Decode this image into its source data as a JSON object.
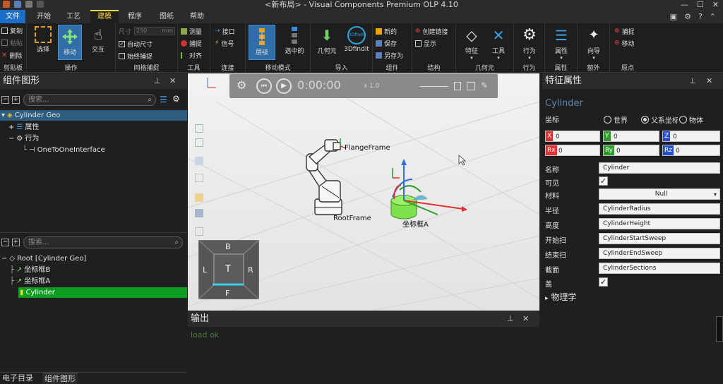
{
  "window": {
    "title": "<新布局> - Visual Components Premium OLP 4.10",
    "min_glyph": "—",
    "max_glyph": "☐",
    "close_glyph": "✕"
  },
  "menu": {
    "tabs": [
      "文件",
      "开始",
      "工艺",
      "建模",
      "程序",
      "图纸",
      "帮助"
    ],
    "active": "建模"
  },
  "ribbon": {
    "clipboard": {
      "label": "剪贴板",
      "copy": "复制",
      "paste": "粘贴",
      "delete": "删除"
    },
    "operation": {
      "label": "操作",
      "select": "选择",
      "move": "移动",
      "interact": "交互"
    },
    "grid": {
      "label": "网格捕捉",
      "size_label": "尺寸",
      "size_value": "250",
      "size_unit": "mm",
      "auto_size": "自动尺寸",
      "always_snap": "始终捕捉"
    },
    "tools": {
      "label": "工具",
      "measure": "测量",
      "snap": "捕捉",
      "align": "对齐"
    },
    "connect": {
      "label": "连接",
      "interface": "接口",
      "signal": "信号"
    },
    "move_mode": {
      "label": "移动模式",
      "hierarchy": "层级",
      "selected": "选中的"
    },
    "import": {
      "label": "导入",
      "geometry": "几何元",
      "findit": "3Dfindit",
      "findit_badge": "3Dfindit"
    },
    "component": {
      "label": "组件",
      "new": "新的",
      "save": "保存",
      "save_as": "另存为"
    },
    "structure": {
      "label": "结构",
      "create_link": "创建链接",
      "show": "显示"
    },
    "geometry": {
      "label": "几何元",
      "feature": "特征",
      "tools": "工具"
    },
    "behavior": {
      "label": "行为",
      "behavior": "行为"
    },
    "properties": {
      "label": "属性",
      "properties": "属性"
    },
    "extra": {
      "label": "额外",
      "wizard": "向导"
    },
    "origin": {
      "label": "原点",
      "snap": "捕捉",
      "move": "移动"
    }
  },
  "component_panel": {
    "title": "组件图形",
    "search_placeholder": "搜索...",
    "tree": [
      {
        "label": "Cylinder Geo",
        "level": 0
      },
      {
        "label": "属性",
        "level": 1
      },
      {
        "label": "行为",
        "level": 1
      },
      {
        "label": "OneToOneInterface",
        "level": 2
      }
    ]
  },
  "graph_panel": {
    "search_placeholder": "搜索...",
    "tree": [
      {
        "label": "Root [Cylinder Geo]",
        "level": 0
      },
      {
        "label": "坐标框B",
        "level": 1
      },
      {
        "label": "坐标框A",
        "level": 1
      },
      {
        "label": "Cylinder",
        "level": 1
      }
    ]
  },
  "viewport": {
    "player_time": "0:00:00",
    "player_speed": "x 1.0",
    "labels": {
      "flange": "FlangeFrame",
      "root": "RootFrame",
      "frame": "坐标框A"
    },
    "navcube": {
      "top": "B",
      "left": "L",
      "center": "T",
      "right": "R",
      "bottom": "F"
    }
  },
  "output_panel": {
    "title": "输出",
    "text": "load ok"
  },
  "property_panel": {
    "title": "特征属性",
    "subtitle": "Cylinder",
    "coord_label": "坐标",
    "coord_options": [
      "世界",
      "父系坐标",
      "物体"
    ],
    "coord_selected": "父系坐标",
    "x": "0",
    "y": "0",
    "z": "0",
    "rx": "0",
    "ry": "0",
    "rz": "0",
    "name_label": "名称",
    "name_value": "Cylinder",
    "visible_label": "可见",
    "material_label": "材料",
    "material_value": "Null",
    "radius_label": "半径",
    "radius_value": "CylinderRadius",
    "height_label": "高度",
    "height_value": "CylinderHeight",
    "start_label": "开始扫",
    "start_value": "CylinderStartSweep",
    "end_label": "结束扫",
    "end_value": "CylinderEndSweep",
    "sections_label": "截面",
    "sections_value": "CylinderSections",
    "cap_label": "盖",
    "physics_label": "物理学"
  },
  "bottom_tabs": [
    "电子目录",
    "组件图形"
  ],
  "colors": {
    "accent": "#ffd445",
    "selection_green": "#0b9c20",
    "file_tab": "#1c6fc9"
  }
}
